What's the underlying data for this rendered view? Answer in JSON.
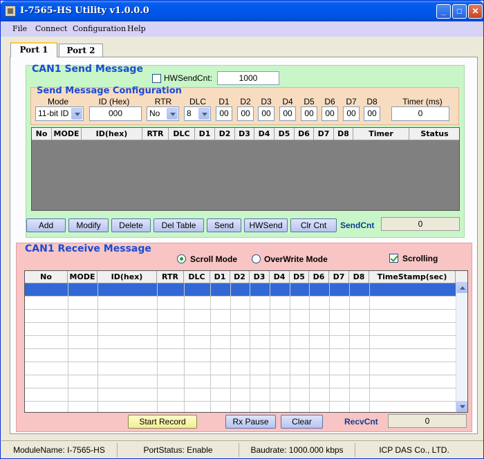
{
  "window": {
    "title": "I-7565-HS Utility v1.0.0.0",
    "icon": "app-icon"
  },
  "titlebar_buttons": {
    "minimize": "_",
    "maximize": "□",
    "close": "✕"
  },
  "menu": [
    "File",
    "Connect",
    "Configuration",
    "Help"
  ],
  "tabs": [
    {
      "label": "Port 1",
      "active": true
    },
    {
      "label": "Port 2",
      "active": false
    }
  ],
  "send": {
    "title": "CAN1 Send Message",
    "hwsendcnt_label": "HWSendCnt:",
    "hwsendcnt_value": "1000",
    "hwsendcnt_checked": false,
    "config": {
      "title": "Send Message Configuration",
      "labels": {
        "mode": "Mode",
        "id": "ID (Hex)",
        "rtr": "RTR",
        "dlc": "DLC",
        "timer": "Timer (ms)"
      },
      "data_labels": [
        "D1",
        "D2",
        "D3",
        "D4",
        "D5",
        "D6",
        "D7",
        "D8"
      ],
      "mode_value": "11-bit ID",
      "id_value": "000",
      "rtr_value": "No",
      "dlc_value": "8",
      "data_values": [
        "00",
        "00",
        "00",
        "00",
        "00",
        "00",
        "00",
        "00"
      ],
      "timer_value": "0"
    },
    "table_columns": [
      "No",
      "MODE",
      "ID(hex)",
      "RTR",
      "DLC",
      "D1",
      "D2",
      "D3",
      "D4",
      "D5",
      "D6",
      "D7",
      "D8",
      "Timer",
      "Status"
    ],
    "buttons": [
      "Add",
      "Modify",
      "Delete",
      "Del Table",
      "Send",
      "HWSend",
      "Clr Cnt"
    ],
    "sendcnt_label": "SendCnt",
    "sendcnt_value": "0"
  },
  "receive": {
    "title": "CAN1 Receive Message",
    "scroll_mode_label": "Scroll Mode",
    "overwrite_mode_label": "OverWrite Mode",
    "mode_selected": "Scroll Mode",
    "scrolling_label": "Scrolling",
    "scrolling_checked": true,
    "table_columns": [
      "No",
      "MODE",
      "ID(hex)",
      "RTR",
      "DLC",
      "D1",
      "D2",
      "D3",
      "D4",
      "D5",
      "D6",
      "D7",
      "D8",
      "TimeStamp(sec)"
    ],
    "buttons": {
      "start_record": "Start Record",
      "rx_pause": "Rx Pause",
      "clear": "Clear"
    },
    "recvcnt_label": "RecvCnt",
    "recvcnt_value": "0"
  },
  "status": {
    "module": "ModuleName: I-7565-HS",
    "port": "PortStatus: Enable",
    "baud": "Baudrate: 1000.000 kbps",
    "company": "ICP DAS Co., LTD."
  }
}
